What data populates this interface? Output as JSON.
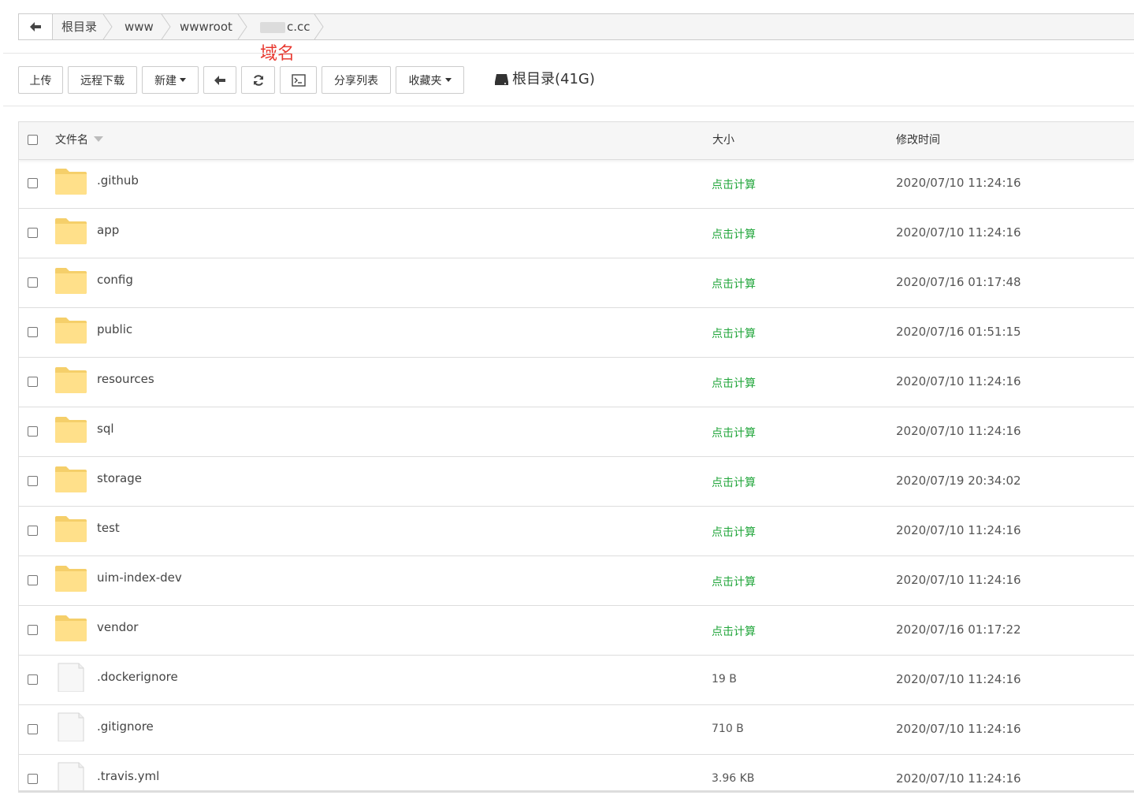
{
  "breadcrumb": {
    "items": [
      "根目录",
      "www",
      "wwwroot",
      "c.cc"
    ]
  },
  "annotation": "域名",
  "toolbar": {
    "upload": "上传",
    "remote_download": "远程下载",
    "new": "新建",
    "share_list": "分享列表",
    "favorites": "收藏夹",
    "disk": "根目录(41G)"
  },
  "table": {
    "columns": {
      "name": "文件名",
      "size": "大小",
      "mtime": "修改时间"
    },
    "rows": [
      {
        "type": "folder",
        "name": ".github",
        "size": "点击计算",
        "mtime": "2020/07/10 11:24:16"
      },
      {
        "type": "folder",
        "name": "app",
        "size": "点击计算",
        "mtime": "2020/07/10 11:24:16"
      },
      {
        "type": "folder",
        "name": "config",
        "size": "点击计算",
        "mtime": "2020/07/16 01:17:48"
      },
      {
        "type": "folder",
        "name": "public",
        "size": "点击计算",
        "mtime": "2020/07/16 01:51:15"
      },
      {
        "type": "folder",
        "name": "resources",
        "size": "点击计算",
        "mtime": "2020/07/10 11:24:16"
      },
      {
        "type": "folder",
        "name": "sql",
        "size": "点击计算",
        "mtime": "2020/07/10 11:24:16"
      },
      {
        "type": "folder",
        "name": "storage",
        "size": "点击计算",
        "mtime": "2020/07/19 20:34:02"
      },
      {
        "type": "folder",
        "name": "test",
        "size": "点击计算",
        "mtime": "2020/07/10 11:24:16"
      },
      {
        "type": "folder",
        "name": "uim-index-dev",
        "size": "点击计算",
        "mtime": "2020/07/10 11:24:16"
      },
      {
        "type": "folder",
        "name": "vendor",
        "size": "点击计算",
        "mtime": "2020/07/16 01:17:22"
      },
      {
        "type": "file",
        "name": ".dockerignore",
        "size": "19 B",
        "mtime": "2020/07/10 11:24:16"
      },
      {
        "type": "file",
        "name": ".gitignore",
        "size": "710 B",
        "mtime": "2020/07/10 11:24:16"
      },
      {
        "type": "file",
        "name": ".travis.yml",
        "size": "3.96 KB",
        "mtime": "2020/07/10 11:24:16"
      }
    ]
  },
  "colors": {
    "calc_link": "#20a53a",
    "annotation": "#e8382f",
    "folder": "#ffe08a"
  }
}
